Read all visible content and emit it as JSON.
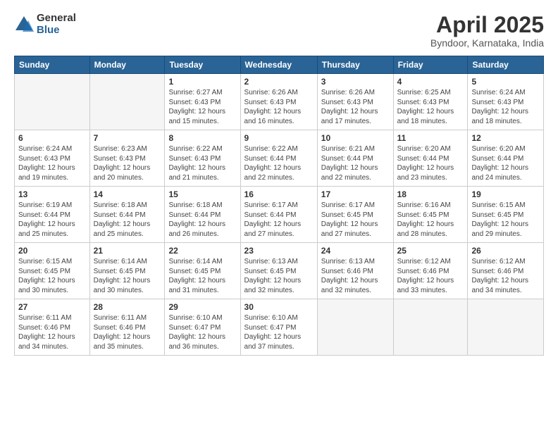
{
  "header": {
    "logo_general": "General",
    "logo_blue": "Blue",
    "title": "April 2025",
    "subtitle": "Byndoor, Karnataka, India"
  },
  "calendar": {
    "days_of_week": [
      "Sunday",
      "Monday",
      "Tuesday",
      "Wednesday",
      "Thursday",
      "Friday",
      "Saturday"
    ],
    "weeks": [
      [
        {
          "day": "",
          "info": ""
        },
        {
          "day": "",
          "info": ""
        },
        {
          "day": "1",
          "info": "Sunrise: 6:27 AM\nSunset: 6:43 PM\nDaylight: 12 hours and 15 minutes."
        },
        {
          "day": "2",
          "info": "Sunrise: 6:26 AM\nSunset: 6:43 PM\nDaylight: 12 hours and 16 minutes."
        },
        {
          "day": "3",
          "info": "Sunrise: 6:26 AM\nSunset: 6:43 PM\nDaylight: 12 hours and 17 minutes."
        },
        {
          "day": "4",
          "info": "Sunrise: 6:25 AM\nSunset: 6:43 PM\nDaylight: 12 hours and 18 minutes."
        },
        {
          "day": "5",
          "info": "Sunrise: 6:24 AM\nSunset: 6:43 PM\nDaylight: 12 hours and 18 minutes."
        }
      ],
      [
        {
          "day": "6",
          "info": "Sunrise: 6:24 AM\nSunset: 6:43 PM\nDaylight: 12 hours and 19 minutes."
        },
        {
          "day": "7",
          "info": "Sunrise: 6:23 AM\nSunset: 6:43 PM\nDaylight: 12 hours and 20 minutes."
        },
        {
          "day": "8",
          "info": "Sunrise: 6:22 AM\nSunset: 6:43 PM\nDaylight: 12 hours and 21 minutes."
        },
        {
          "day": "9",
          "info": "Sunrise: 6:22 AM\nSunset: 6:44 PM\nDaylight: 12 hours and 22 minutes."
        },
        {
          "day": "10",
          "info": "Sunrise: 6:21 AM\nSunset: 6:44 PM\nDaylight: 12 hours and 22 minutes."
        },
        {
          "day": "11",
          "info": "Sunrise: 6:20 AM\nSunset: 6:44 PM\nDaylight: 12 hours and 23 minutes."
        },
        {
          "day": "12",
          "info": "Sunrise: 6:20 AM\nSunset: 6:44 PM\nDaylight: 12 hours and 24 minutes."
        }
      ],
      [
        {
          "day": "13",
          "info": "Sunrise: 6:19 AM\nSunset: 6:44 PM\nDaylight: 12 hours and 25 minutes."
        },
        {
          "day": "14",
          "info": "Sunrise: 6:18 AM\nSunset: 6:44 PM\nDaylight: 12 hours and 25 minutes."
        },
        {
          "day": "15",
          "info": "Sunrise: 6:18 AM\nSunset: 6:44 PM\nDaylight: 12 hours and 26 minutes."
        },
        {
          "day": "16",
          "info": "Sunrise: 6:17 AM\nSunset: 6:44 PM\nDaylight: 12 hours and 27 minutes."
        },
        {
          "day": "17",
          "info": "Sunrise: 6:17 AM\nSunset: 6:45 PM\nDaylight: 12 hours and 27 minutes."
        },
        {
          "day": "18",
          "info": "Sunrise: 6:16 AM\nSunset: 6:45 PM\nDaylight: 12 hours and 28 minutes."
        },
        {
          "day": "19",
          "info": "Sunrise: 6:15 AM\nSunset: 6:45 PM\nDaylight: 12 hours and 29 minutes."
        }
      ],
      [
        {
          "day": "20",
          "info": "Sunrise: 6:15 AM\nSunset: 6:45 PM\nDaylight: 12 hours and 30 minutes."
        },
        {
          "day": "21",
          "info": "Sunrise: 6:14 AM\nSunset: 6:45 PM\nDaylight: 12 hours and 30 minutes."
        },
        {
          "day": "22",
          "info": "Sunrise: 6:14 AM\nSunset: 6:45 PM\nDaylight: 12 hours and 31 minutes."
        },
        {
          "day": "23",
          "info": "Sunrise: 6:13 AM\nSunset: 6:45 PM\nDaylight: 12 hours and 32 minutes."
        },
        {
          "day": "24",
          "info": "Sunrise: 6:13 AM\nSunset: 6:46 PM\nDaylight: 12 hours and 32 minutes."
        },
        {
          "day": "25",
          "info": "Sunrise: 6:12 AM\nSunset: 6:46 PM\nDaylight: 12 hours and 33 minutes."
        },
        {
          "day": "26",
          "info": "Sunrise: 6:12 AM\nSunset: 6:46 PM\nDaylight: 12 hours and 34 minutes."
        }
      ],
      [
        {
          "day": "27",
          "info": "Sunrise: 6:11 AM\nSunset: 6:46 PM\nDaylight: 12 hours and 34 minutes."
        },
        {
          "day": "28",
          "info": "Sunrise: 6:11 AM\nSunset: 6:46 PM\nDaylight: 12 hours and 35 minutes."
        },
        {
          "day": "29",
          "info": "Sunrise: 6:10 AM\nSunset: 6:47 PM\nDaylight: 12 hours and 36 minutes."
        },
        {
          "day": "30",
          "info": "Sunrise: 6:10 AM\nSunset: 6:47 PM\nDaylight: 12 hours and 37 minutes."
        },
        {
          "day": "",
          "info": ""
        },
        {
          "day": "",
          "info": ""
        },
        {
          "day": "",
          "info": ""
        }
      ]
    ]
  }
}
